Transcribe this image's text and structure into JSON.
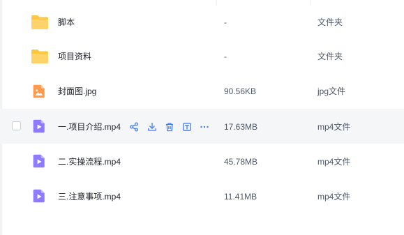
{
  "colors": {
    "folder": "#ffc740",
    "image_file": "#ff9a4a",
    "video_file": "#8e7bff",
    "action_icon": "#3f7cf6",
    "row_hover": "#f5f6f8"
  },
  "files": [
    {
      "name": "脚本",
      "size": "-",
      "type": "文件夹",
      "icon": "folder-icon"
    },
    {
      "name": "项目资料",
      "size": "-",
      "type": "文件夹",
      "icon": "folder-icon"
    },
    {
      "name": "封面图.jpg",
      "size": "90.56KB",
      "type": "jpg文件",
      "icon": "image-file-icon"
    },
    {
      "name": "一.项目介绍.mp4",
      "size": "17.63MB",
      "type": "mp4文件",
      "icon": "video-file-icon"
    },
    {
      "name": "二.实操流程.mp4",
      "size": "45.78MB",
      "type": "mp4文件",
      "icon": "video-file-icon"
    },
    {
      "name": "三.注意事项.mp4",
      "size": "11.41MB",
      "type": "mp4文件",
      "icon": "video-file-icon"
    }
  ],
  "row_actions": [
    "share-icon",
    "download-icon",
    "delete-icon",
    "rename-icon",
    "more-icon"
  ]
}
